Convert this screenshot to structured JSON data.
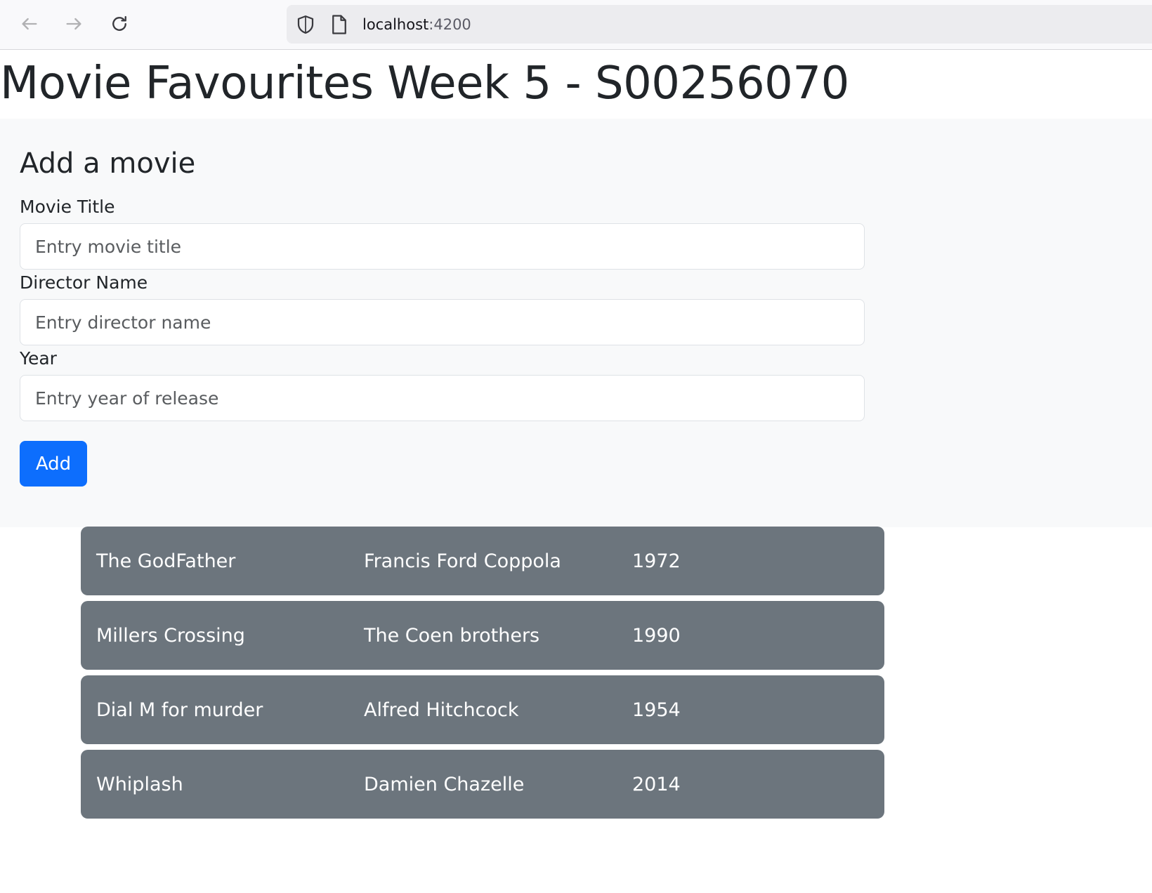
{
  "browser": {
    "url_host": "localhost",
    "url_port": ":4200"
  },
  "page": {
    "title": "Movie Favourites Week 5 - S00256070"
  },
  "form": {
    "heading": "Add a movie",
    "fields": [
      {
        "label": "Movie Title",
        "placeholder": "Entry movie title",
        "value": ""
      },
      {
        "label": "Director Name",
        "placeholder": "Entry director name",
        "value": ""
      },
      {
        "label": "Year",
        "placeholder": "Entry year of release",
        "value": ""
      }
    ],
    "submit_label": "Add"
  },
  "movies": [
    {
      "title": "The GodFather",
      "director": "Francis Ford Coppola",
      "year": "1972"
    },
    {
      "title": "Millers Crossing",
      "director": "The Coen brothers",
      "year": "1990"
    },
    {
      "title": "Dial M for murder",
      "director": "Alfred Hitchcock",
      "year": "1954"
    },
    {
      "title": "Whiplash",
      "director": "Damien Chazelle",
      "year": "2014"
    }
  ],
  "colors": {
    "primary": "#0d6efd",
    "row_background": "#6c757d",
    "form_background": "#f8f9fa"
  }
}
